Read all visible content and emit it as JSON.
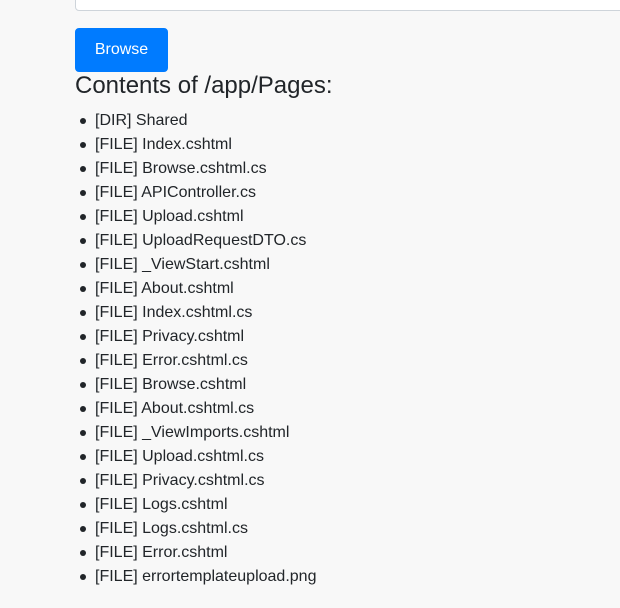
{
  "browse_button": {
    "label": "Browse"
  },
  "heading": "Contents of /app/Pages:",
  "entries": [
    "[DIR] Shared",
    "[FILE] Index.cshtml",
    "[FILE] Browse.cshtml.cs",
    "[FILE] APIController.cs",
    "[FILE] Upload.cshtml",
    "[FILE] UploadRequestDTO.cs",
    "[FILE] _ViewStart.cshtml",
    "[FILE] About.cshtml",
    "[FILE] Index.cshtml.cs",
    "[FILE] Privacy.cshtml",
    "[FILE] Error.cshtml.cs",
    "[FILE] Browse.cshtml",
    "[FILE] About.cshtml.cs",
    "[FILE] _ViewImports.cshtml",
    "[FILE] Upload.cshtml.cs",
    "[FILE] Privacy.cshtml.cs",
    "[FILE] Logs.cshtml",
    "[FILE] Logs.cshtml.cs",
    "[FILE] Error.cshtml",
    "[FILE] errortemplateupload.png"
  ],
  "colors": {
    "accent": "#007bff",
    "background": "#f8f8f8",
    "text": "#212529"
  }
}
